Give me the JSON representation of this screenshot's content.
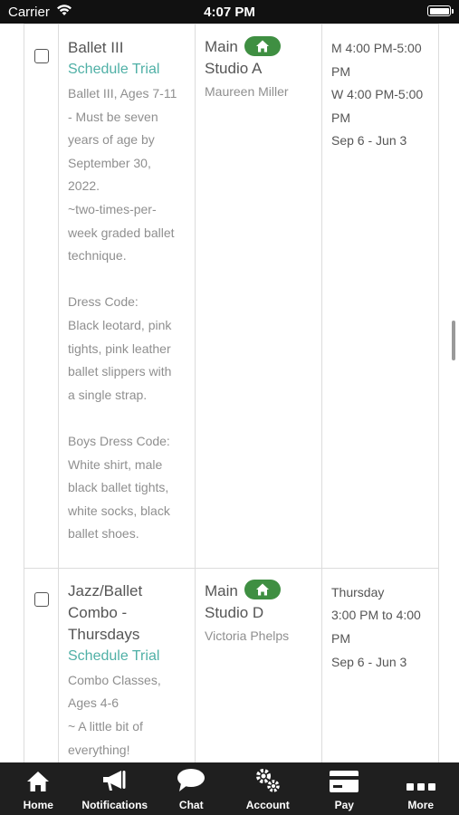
{
  "status_bar": {
    "carrier": "Carrier",
    "time": "4:07 PM"
  },
  "classes": [
    {
      "title": "Ballet III",
      "trial_label": "Schedule Trial",
      "description": "Ballet III, Ages 7-11\n- Must be seven\nyears of age by\nSeptember 30,\n2022.\n~two-times-per-\nweek graded ballet\ntechnique.\n\nDress Code:\nBlack leotard, pink\ntights, pink leather\nballet slippers with\na single strap.\n\nBoys Dress Code:\nWhite shirt, male\nblack ballet tights,\nwhite socks, black\nballet shoes.",
      "location": "Main",
      "studio": "Studio A",
      "teacher": "Maureen Miller",
      "schedule": [
        "M 4:00 PM-5:00",
        "PM",
        "W 4:00 PM-5:00",
        "PM",
        "Sep 6 - Jun 3"
      ]
    },
    {
      "title": "Jazz/Ballet\nCombo -\nThursdays",
      "trial_label": "Schedule Trial",
      "description": "Combo Classes,\nAges 4-6\n~ A little bit of\neverything!",
      "location": "Main",
      "studio": "Studio D",
      "teacher": "Victoria Phelps",
      "schedule": [
        "Thursday",
        "3:00 PM to 4:00",
        "PM",
        "Sep 6 - Jun 3"
      ]
    }
  ],
  "tab_bar": [
    {
      "label": "Home",
      "icon": "home-icon"
    },
    {
      "label": "Notifications",
      "icon": "megaphone-icon"
    },
    {
      "label": "Chat",
      "icon": "chat-icon"
    },
    {
      "label": "Account",
      "icon": "gears-icon"
    },
    {
      "label": "Pay",
      "icon": "credit-card-icon"
    },
    {
      "label": "More",
      "icon": "more-icon"
    }
  ]
}
